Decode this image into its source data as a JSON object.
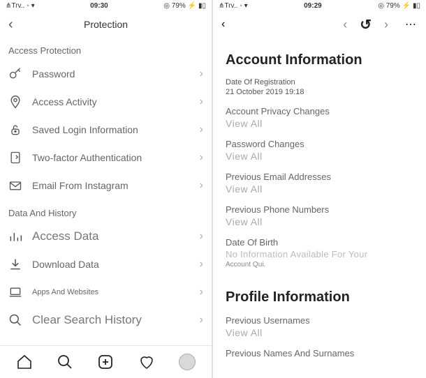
{
  "left": {
    "status": {
      "carrier": "⋔Trv..",
      "time": "09:30",
      "batt": "◎ 79% ⚡"
    },
    "header": {
      "title": "Protection"
    },
    "sections": [
      {
        "title": "Access Protection",
        "items": [
          {
            "icon": "key",
            "label": "Password",
            "size": "norm"
          },
          {
            "icon": "pin",
            "label": "Access Activity",
            "size": "norm"
          },
          {
            "icon": "lock",
            "label": "Saved Login Information",
            "size": "norm"
          },
          {
            "icon": "device",
            "label": "Two-factor Authentication",
            "size": "norm"
          },
          {
            "icon": "mail",
            "label": "Email From Instagram",
            "size": "norm"
          }
        ]
      },
      {
        "title": "Data And History",
        "items": [
          {
            "icon": "bars",
            "label": "Access Data",
            "size": "large"
          },
          {
            "icon": "download",
            "label": "Download Data",
            "size": "norm"
          },
          {
            "icon": "laptop",
            "label": "Apps And Websites",
            "size": "small"
          },
          {
            "icon": "search",
            "label": "Clear Search History",
            "size": "large"
          }
        ]
      }
    ]
  },
  "right": {
    "status": {
      "carrier": "⋔Trv..",
      "time": "09:29",
      "batt": "◎ 79% ⚡"
    },
    "title1": "Account Information",
    "reg_lbl": "Date Of Registration",
    "reg_val": "21 October 2019  19:18",
    "s1": "Account Privacy Changes",
    "s2": "Password Changes",
    "s3": "Previous Email Addresses",
    "s4": "Previous Phone Numbers",
    "s5": "Date Of Birth",
    "no_info": "No Information Available For Your",
    "acct_qui": "Account Qui.",
    "view_all": "View All",
    "title2": "Profile Information",
    "p1": "Previous Usernames",
    "p2": "Previous Names And Surnames"
  }
}
